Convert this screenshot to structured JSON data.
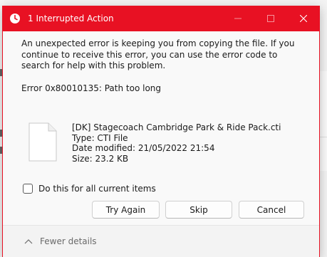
{
  "window": {
    "title": "1 Interrupted Action",
    "minimize_icon": "minimize-icon",
    "maximize_icon": "maximize-icon",
    "close_icon": "close-icon",
    "title_icon": "clock-icon",
    "accent_color": "#e81123"
  },
  "message": {
    "text": "An unexpected error is keeping you from copying the file. If you continue to receive this error, you can use the error code to search for help with this problem.",
    "error": "Error 0x80010135: Path too long"
  },
  "file": {
    "name": "[DK] Stagecoach Cambridge Park & Ride Pack.cti",
    "type": "Type: CTI File",
    "modified": "Date modified: 21/05/2022 21:54",
    "size": "Size: 23.2 KB",
    "icon": "document-icon"
  },
  "options": {
    "apply_all_label": "Do this for all current items",
    "apply_all_checked": false
  },
  "buttons": {
    "try_again": "Try Again",
    "skip": "Skip",
    "cancel": "Cancel"
  },
  "footer": {
    "toggle_label": "Fewer details",
    "toggle_icon": "chevron-up-icon"
  }
}
